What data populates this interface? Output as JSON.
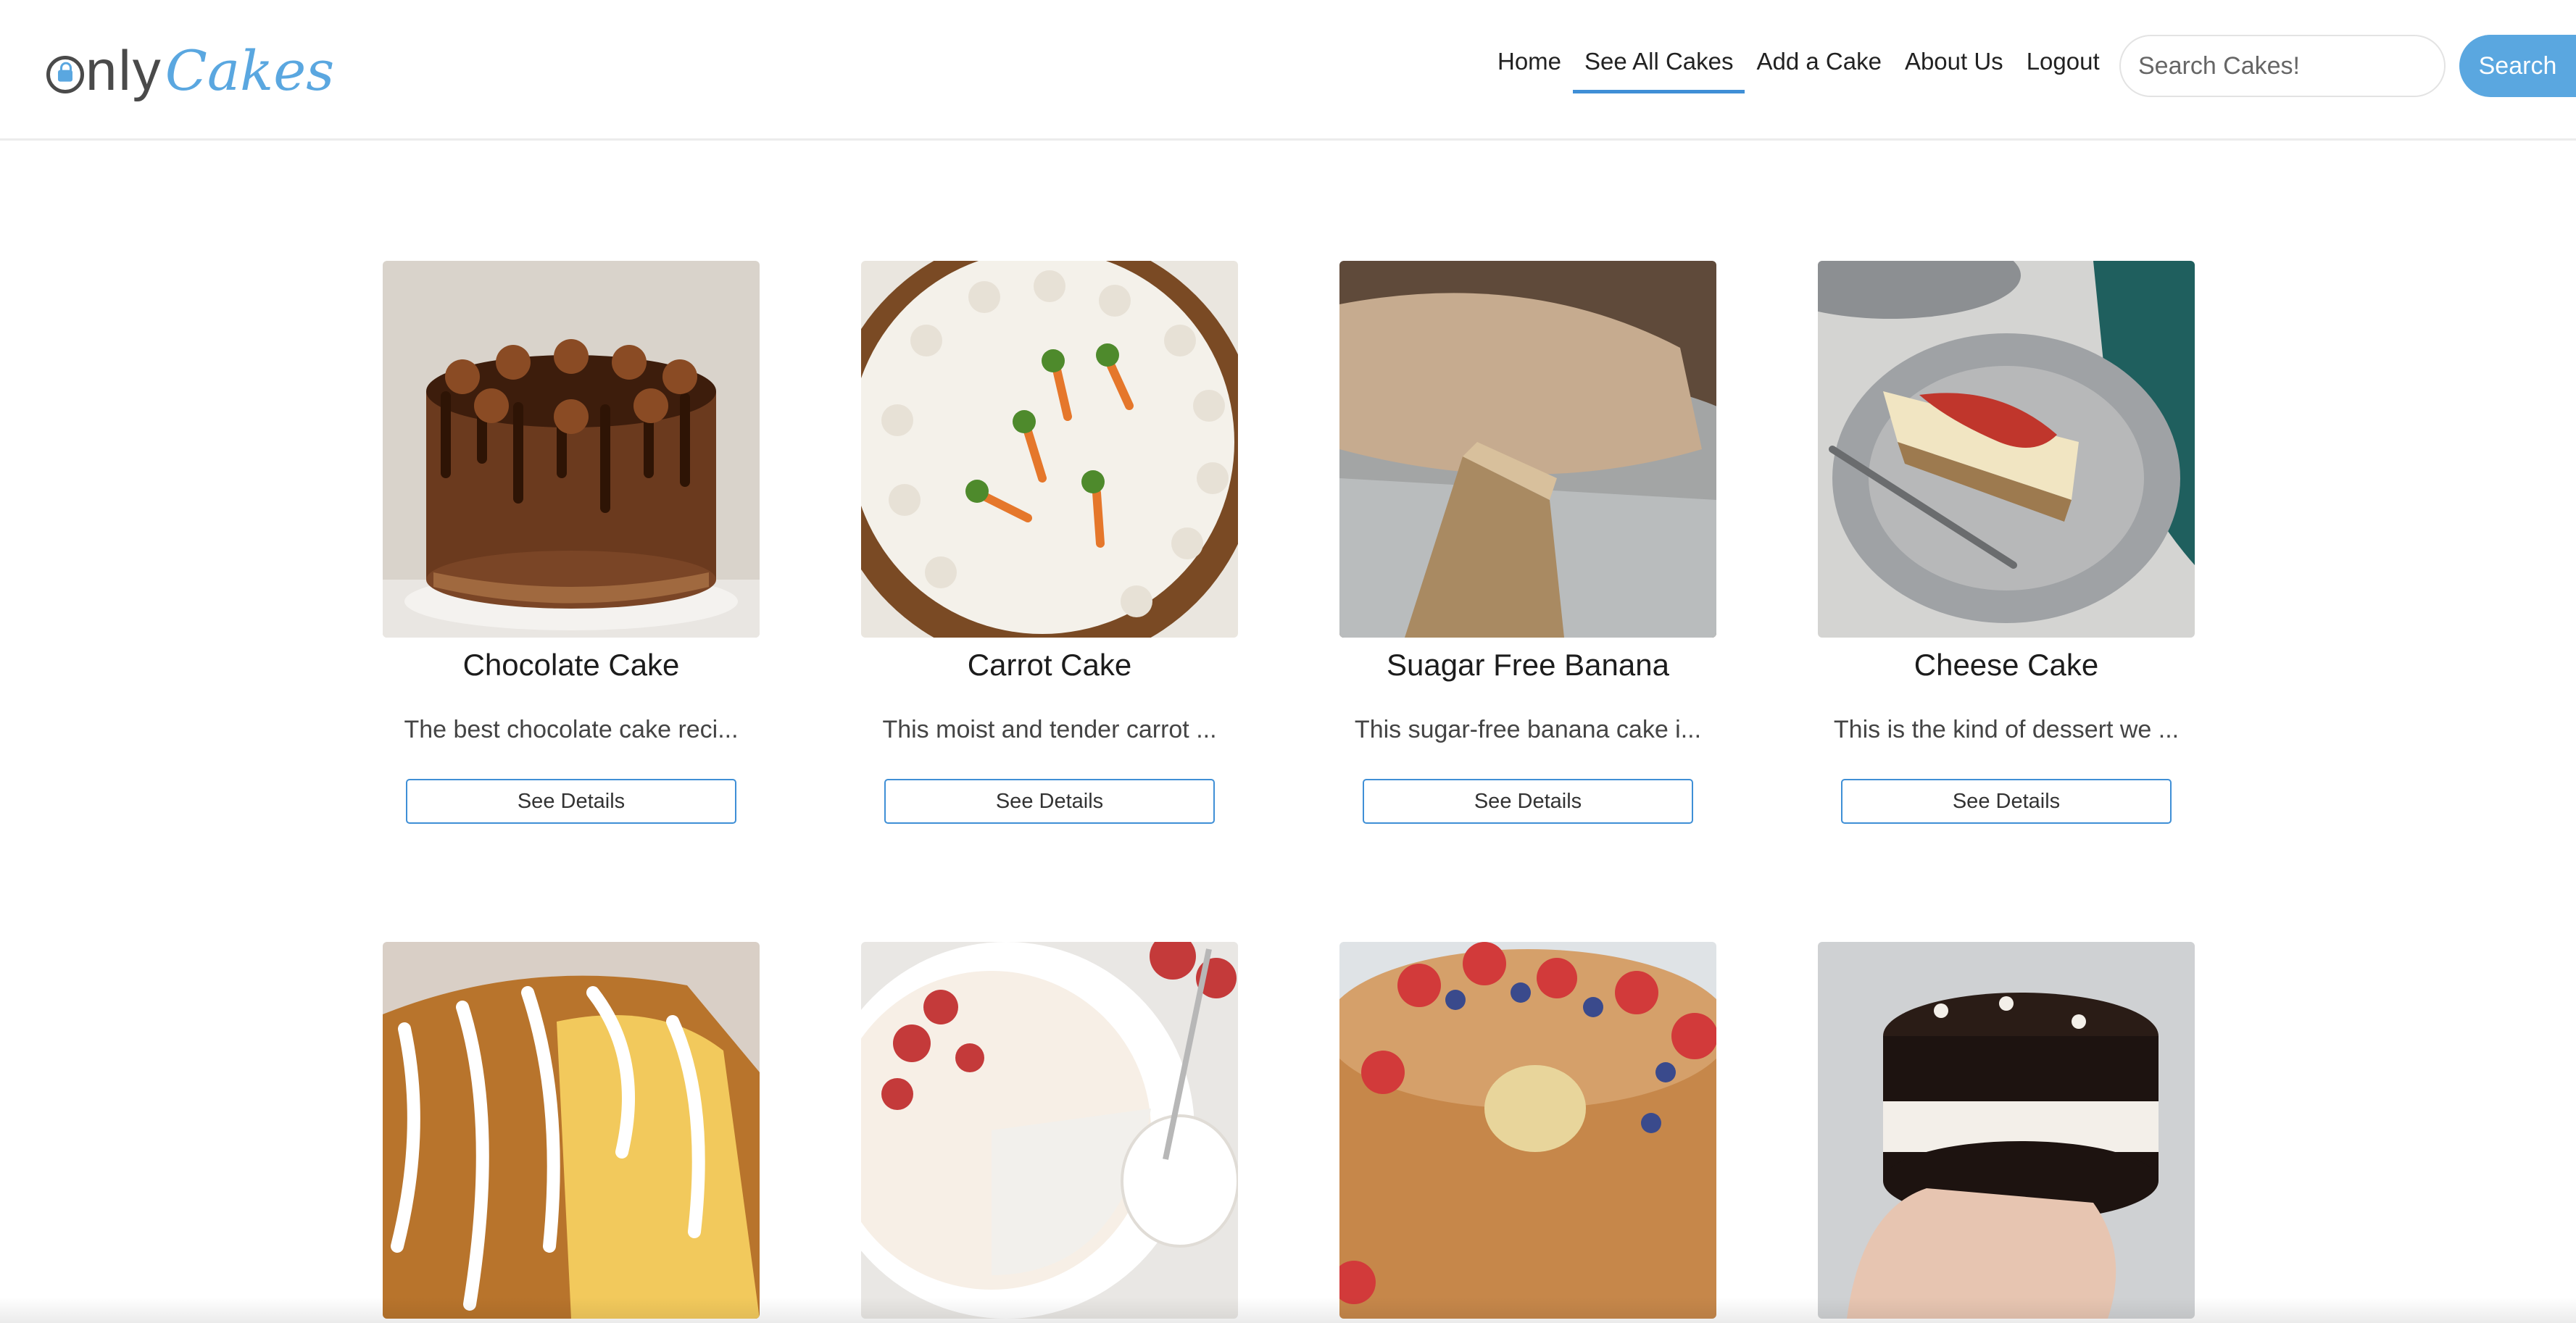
{
  "logo": {
    "part1": "nly",
    "part2": "Cakes"
  },
  "nav": {
    "links": [
      "Home",
      "See All Cakes",
      "Add a Cake",
      "About Us",
      "Logout"
    ],
    "active_index": 1
  },
  "search": {
    "placeholder": "Search Cakes!",
    "button_label": "Search"
  },
  "colors": {
    "accent": "#5aa7e0",
    "link_underline": "#3f8fd6"
  },
  "cakes": [
    {
      "title": "Chocolate Cake",
      "desc": "The best chocolate cake reci...",
      "button": "See Details"
    },
    {
      "title": "Carrot Cake",
      "desc": "This moist and tender carrot ...",
      "button": "See Details"
    },
    {
      "title": "Suagar Free Banana",
      "desc": "This sugar-free banana cake i...",
      "button": "See Details"
    },
    {
      "title": "Cheese Cake",
      "desc": "This is the kind of dessert we ...",
      "button": "See Details"
    },
    {
      "title": "",
      "desc": "",
      "button": ""
    },
    {
      "title": "",
      "desc": "",
      "button": ""
    },
    {
      "title": "",
      "desc": "",
      "button": ""
    },
    {
      "title": "",
      "desc": "",
      "button": ""
    }
  ]
}
